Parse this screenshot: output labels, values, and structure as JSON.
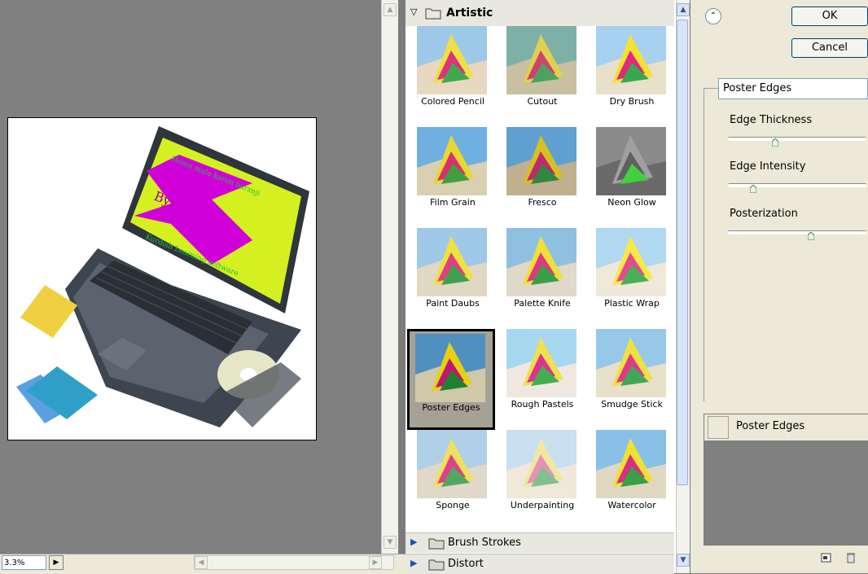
{
  "preview": {
    "zoom": "3.3%",
    "artwork_text": {
      "line1": "Hemn mala karim barznji",
      "line2": "By:",
      "line3": "Kurdish Learning software"
    }
  },
  "gallery": {
    "category": "Artistic",
    "filters": [
      {
        "label": "Colored Pencil"
      },
      {
        "label": "Cutout"
      },
      {
        "label": "Dry Brush"
      },
      {
        "label": "Film Grain"
      },
      {
        "label": "Fresco"
      },
      {
        "label": "Neon Glow"
      },
      {
        "label": "Paint Daubs"
      },
      {
        "label": "Palette Knife"
      },
      {
        "label": "Plastic Wrap"
      },
      {
        "label": "Poster Edges"
      },
      {
        "label": "Rough Pastels"
      },
      {
        "label": "Smudge Stick"
      },
      {
        "label": "Sponge"
      },
      {
        "label": "Underpainting"
      },
      {
        "label": "Watercolor"
      }
    ],
    "selected_filter": "Poster Edges",
    "collapsed_groups": [
      "Brush Strokes",
      "Distort"
    ]
  },
  "panel": {
    "ok_label": "OK",
    "cancel_label": "Cancel",
    "filter_select_value": "Poster Edges",
    "params": [
      {
        "label": "Edge Thickness",
        "value_fraction": 0.34
      },
      {
        "label": "Edge Intensity",
        "value_fraction": 0.18
      },
      {
        "label": "Posterization",
        "value_fraction": 0.6
      }
    ],
    "layer_name": "Poster Edges",
    "icons": [
      "collapse-icon",
      "new-layer-icon",
      "trash-icon"
    ]
  }
}
